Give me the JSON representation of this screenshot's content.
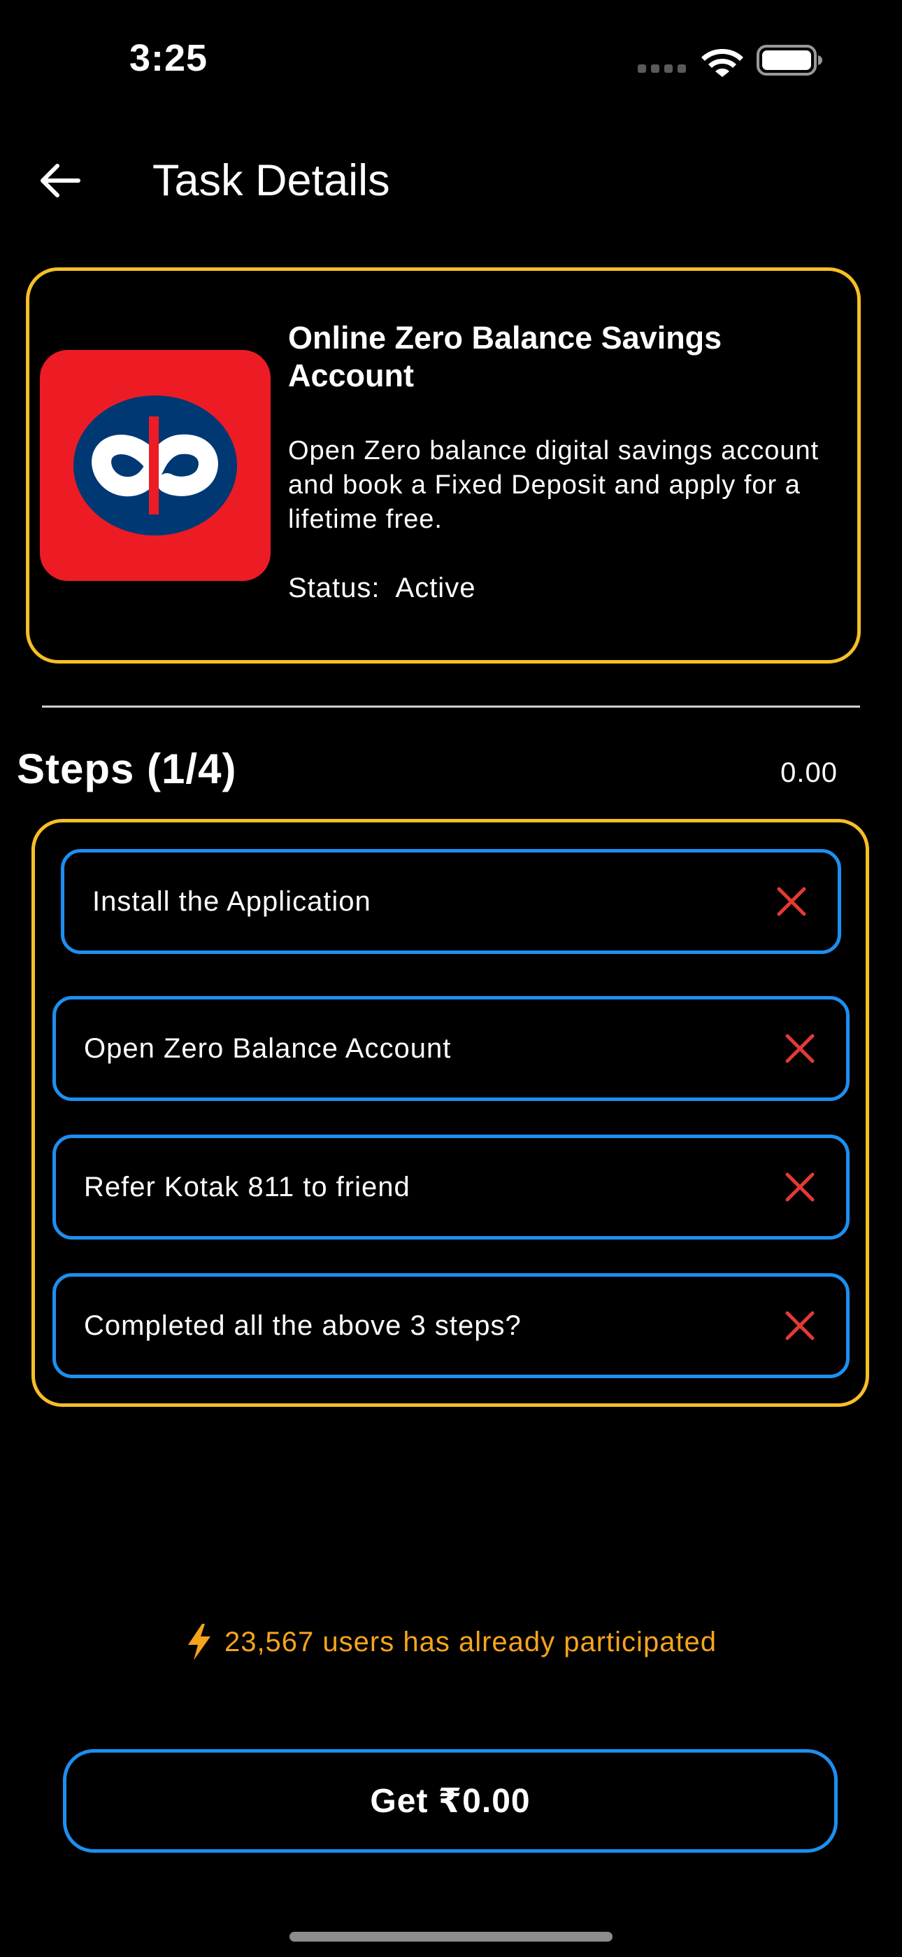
{
  "status_bar": {
    "time": "3:25"
  },
  "header": {
    "title": "Task Details"
  },
  "task": {
    "title": "Online Zero Balance Savings Account",
    "description": "Open Zero balance digital savings account and book a Fixed Deposit and apply for a lifetime free.",
    "status_label": "Status:",
    "status_value": "Active"
  },
  "steps": {
    "heading": "Steps (1/4)",
    "amount": "0.00",
    "items": [
      {
        "label": "Install the Application"
      },
      {
        "label": "Open Zero Balance Account"
      },
      {
        "label": "Refer Kotak 811 to friend"
      },
      {
        "label": "Completed all the above 3 steps?"
      }
    ]
  },
  "participation": {
    "text": "23,567 users has already participated"
  },
  "cta": {
    "label": "Get ₹0.00"
  },
  "colors": {
    "card_border": "#f6bf26",
    "step_border": "#1d8ff0",
    "incomplete_mark": "#e53935",
    "participation_text": "#f6a41c",
    "logo_bg": "#ed1c24"
  },
  "icons": {
    "back": "arrow-left-icon",
    "wifi": "wifi-icon",
    "battery": "battery-icon",
    "step_status": "close-icon",
    "participation": "lightning-icon"
  }
}
